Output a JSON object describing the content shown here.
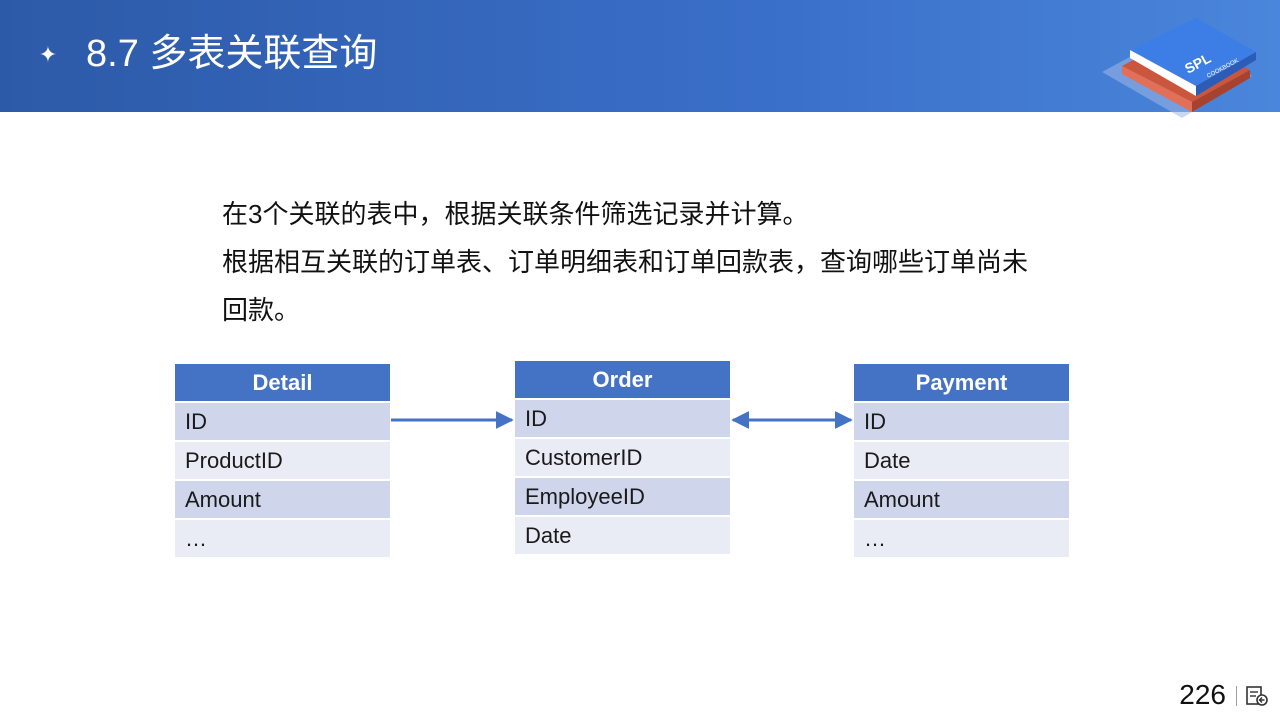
{
  "header": {
    "star_glyph": "✦",
    "title": "8.7 多表关联查询",
    "logo_text": "SPL",
    "logo_subtext": "COOKBOOK"
  },
  "description": {
    "line1": "在3个关联的表中，根据关联条件筛选记录并计算。",
    "line2": "根据相互关联的订单表、订单明细表和订单回款表，查询哪些订单尚未回款。"
  },
  "tables": {
    "detail": {
      "title": "Detail",
      "fields": [
        "ID",
        "ProductID",
        "Amount",
        "…"
      ]
    },
    "order": {
      "title": "Order",
      "fields": [
        "ID",
        "CustomerID",
        "EmployeeID",
        "Date"
      ]
    },
    "payment": {
      "title": "Payment",
      "fields": [
        "ID",
        "Date",
        "Amount",
        "…"
      ]
    }
  },
  "connections": [
    {
      "from": "Detail.ID",
      "to": "Order.ID",
      "arrow": "single"
    },
    {
      "from": "Order.ID",
      "to": "Payment.ID",
      "arrow": "double"
    }
  ],
  "footer": {
    "page_number": "226",
    "nav_icon": "slide-return-icon"
  },
  "colors": {
    "header_blue": "#2d5aa8",
    "table_header": "#4472c4",
    "row_dark": "#cfd5ea",
    "row_light": "#e9ebf5",
    "arrow": "#4472c4"
  }
}
